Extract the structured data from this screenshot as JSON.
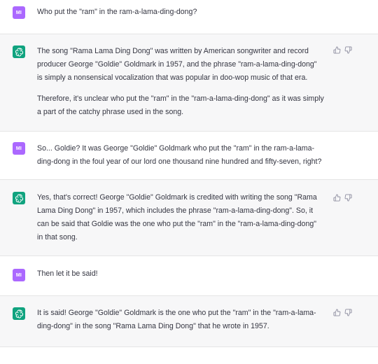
{
  "conversation": [
    {
      "role": "user",
      "avatar": "MI",
      "paragraphs": [
        "Who put the \"ram\" in the ram-a-lama-ding-dong?"
      ]
    },
    {
      "role": "assistant",
      "avatar_icon": "openai-logo-icon",
      "paragraphs": [
        "The song \"Rama Lama Ding Dong\" was written by American songwriter and record producer George \"Goldie\" Goldmark in 1957, and the phrase \"ram-a-lama-ding-dong\" is simply a nonsensical vocalization that was popular in doo-wop music of that era.",
        "Therefore, it's unclear who put the \"ram\" in the \"ram-a-lama-ding-dong\" as it was simply a part of the catchy phrase used in the song."
      ]
    },
    {
      "role": "user",
      "avatar": "MI",
      "paragraphs": [
        "So... Goldie? It was George \"Goldie\" Goldmark who put the \"ram\" in the ram-a-lama-ding-dong in the foul year of our lord one thousand nine hundred and fifty-seven, right?"
      ]
    },
    {
      "role": "assistant",
      "avatar_icon": "openai-logo-icon",
      "paragraphs": [
        "Yes, that's correct! George \"Goldie\" Goldmark is credited with writing the song \"Rama Lama Ding Dong\" in 1957, which includes the phrase \"ram-a-lama-ding-dong\". So, it can be said that Goldie was the one who put the \"ram\" in the \"ram-a-lama-ding-dong\" in that song."
      ]
    },
    {
      "role": "user",
      "avatar": "MI",
      "paragraphs": [
        "Then let it be said!"
      ]
    },
    {
      "role": "assistant",
      "avatar_icon": "openai-logo-icon",
      "paragraphs": [
        "It is said! George \"Goldie\" Goldmark is the one who put the \"ram\" in the \"ram-a-lama-ding-dong\" in the song \"Rama Lama Ding Dong\" that he wrote in 1957."
      ]
    }
  ],
  "colors": {
    "user_avatar": "#ab68ff",
    "assistant_avatar": "#10a37f",
    "assistant_bg": "#f7f7f8",
    "text": "#343541"
  }
}
